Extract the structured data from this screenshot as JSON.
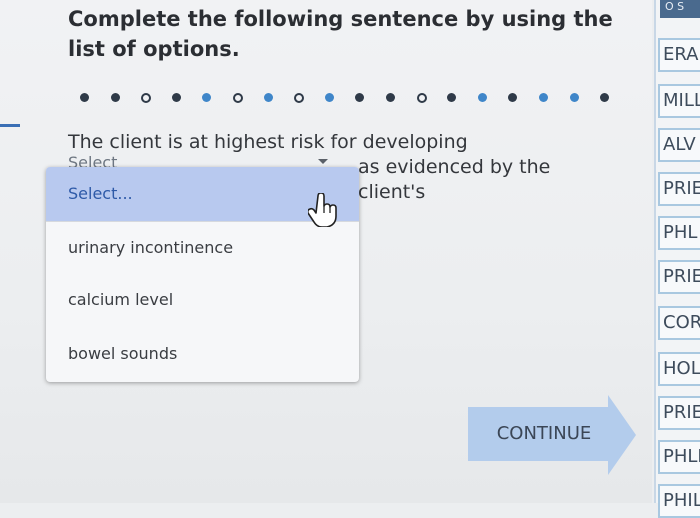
{
  "question": {
    "heading": "Complete the following sentence by using the list of options.",
    "prompt_part1": "The client is at highest risk for developing",
    "prompt_part2": "as evidenced by the client's",
    "select_peek": "Select"
  },
  "progress": {
    "dots": [
      "filled",
      "filled",
      "hollow",
      "filled",
      "accent",
      "hollow",
      "accent",
      "hollow",
      "accent",
      "filled",
      "filled",
      "hollow",
      "filled",
      "accent",
      "filled",
      "accent",
      "accent",
      "filled"
    ]
  },
  "dropdown": {
    "options": [
      {
        "label": "Select...",
        "selected": true
      },
      {
        "label": "urinary incontinence",
        "selected": false
      },
      {
        "label": "calcium level",
        "selected": false
      },
      {
        "label": "bowel sounds",
        "selected": false
      }
    ]
  },
  "continue_button": {
    "label": "CONTINUE"
  },
  "sidebar": {
    "top_label": "O S",
    "items": [
      "ERA",
      "MILL",
      "ALV",
      "PRIE",
      "PHL",
      "PRIE",
      "COR",
      "HOL",
      "PRIE",
      "PHLE",
      "PHIL"
    ]
  },
  "colors": {
    "accent": "#3f86c9",
    "dropdown_selected_bg": "#b8c9ef",
    "button_bg": "#b3ccec"
  }
}
